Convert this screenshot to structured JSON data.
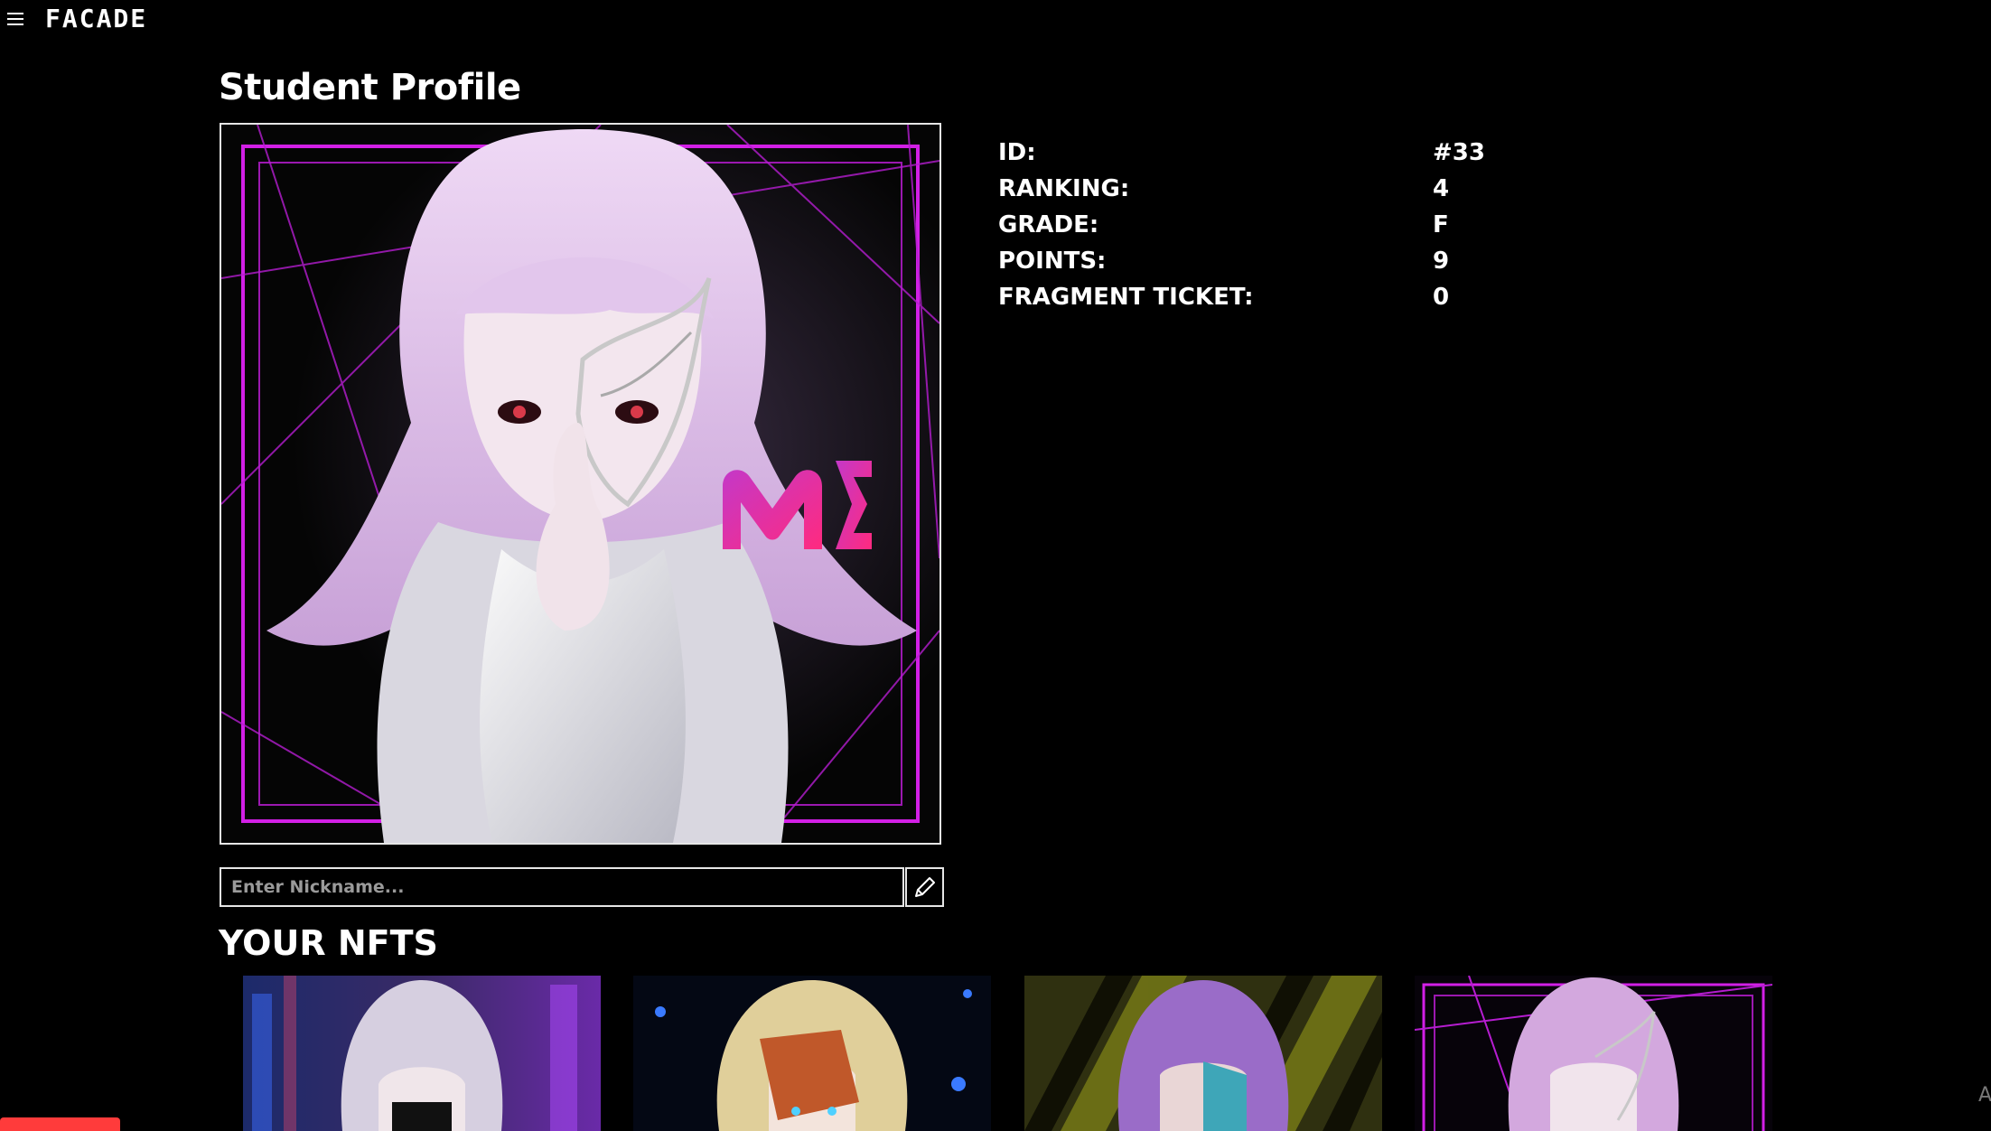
{
  "header": {
    "menu_icon": "hamburger-icon",
    "logo": "FACADE"
  },
  "page": {
    "title": "Student Profile"
  },
  "profile": {
    "image_badge": "ME",
    "stats": [
      {
        "label": "ID:",
        "value": "#33"
      },
      {
        "label": "RANKING:",
        "value": "4"
      },
      {
        "label": "GRADE:",
        "value": "F"
      },
      {
        "label": "POINTS:",
        "value": "9"
      },
      {
        "label": "FRAGMENT TICKET:",
        "value": "0"
      }
    ]
  },
  "nickname": {
    "placeholder": "Enter Nickname...",
    "value": "",
    "edit_icon": "pencil-icon"
  },
  "nfts": {
    "title": "YOUR NFTS",
    "items": [
      {
        "hair": "#d6cfe0",
        "bg": "city-neon"
      },
      {
        "hair": "#e0cf9a",
        "bg": "space-blue"
      },
      {
        "hair": "#9a6cc8",
        "bg": "yellow-stripes"
      },
      {
        "hair": "#d3a8de",
        "bg": "neon-frame"
      }
    ]
  },
  "overlay": {
    "corner_text": "A"
  },
  "colors": {
    "accent": "#d21fe6",
    "logo_pink": "#e0268f",
    "floating_button": "#ff3b3b",
    "background": "#000000"
  }
}
